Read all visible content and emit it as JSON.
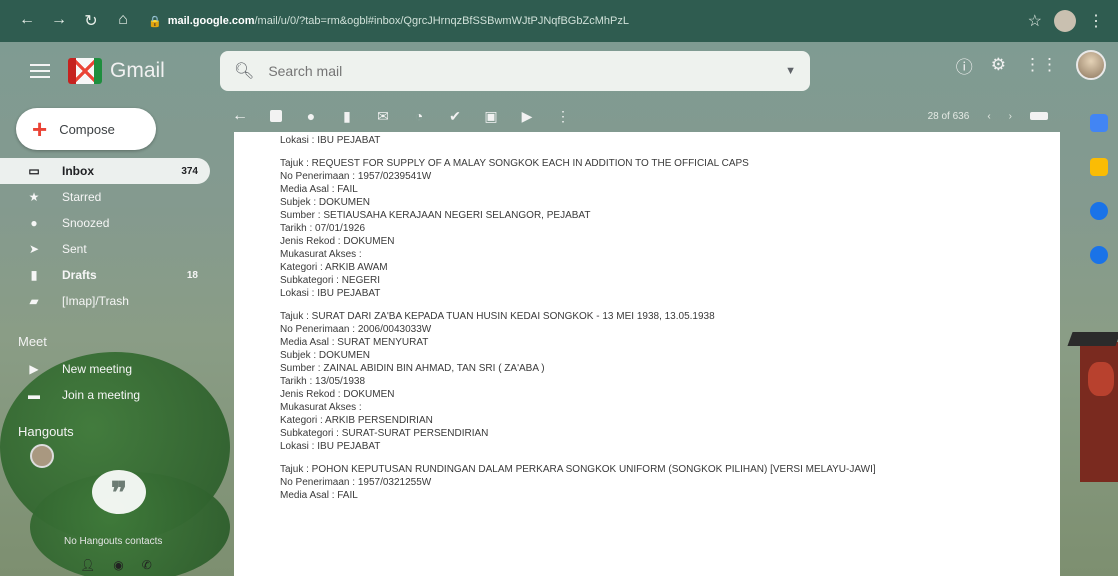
{
  "browser": {
    "url_host": "mail.google.com",
    "url_path": "/mail/u/0/?tab=rm&ogbl#inbox/QgrcJHrnqzBfSSBwmWJtPJNqfBGbZcMhPzL"
  },
  "app": {
    "name": "Gmail"
  },
  "search": {
    "placeholder": "Search mail"
  },
  "compose": {
    "label": "Compose"
  },
  "nav": [
    {
      "label": "Inbox",
      "count": "374",
      "icon": "inbox-icon",
      "glyph": "▭"
    },
    {
      "label": "Starred",
      "count": "",
      "icon": "star-icon",
      "glyph": "★"
    },
    {
      "label": "Snoozed",
      "count": "",
      "icon": "clock-icon",
      "glyph": "●"
    },
    {
      "label": "Sent",
      "count": "",
      "icon": "send-icon",
      "glyph": "➤"
    },
    {
      "label": "Drafts",
      "count": "18",
      "icon": "draft-icon",
      "glyph": "▮"
    },
    {
      "label": "[Imap]/Trash",
      "count": "",
      "icon": "label-icon",
      "glyph": "▰"
    }
  ],
  "meet": {
    "title": "Meet",
    "new_meeting": "New meeting",
    "join": "Join a meeting"
  },
  "hangouts": {
    "title": "Hangouts",
    "no_contacts": "No Hangouts contacts"
  },
  "pager": {
    "text": "28 of 636"
  },
  "message": {
    "lead": "Lokasi : IBU PEJABAT",
    "records": [
      [
        "Tajuk : REQUEST FOR SUPPLY OF A MALAY SONGKOK EACH IN ADDITION TO THE OFFICIAL CAPS",
        "No Penerimaan : 1957/0239541W",
        "Media Asal : FAIL",
        "Subjek : DOKUMEN",
        "Sumber : SETIAUSAHA KERAJAAN NEGERI SELANGOR, PEJABAT",
        "Tarikh : 07/01/1926",
        "Jenis Rekod : DOKUMEN",
        "Mukasurat Akses :",
        "Kategori : ARKIB AWAM",
        "Subkategori : NEGERI",
        "Lokasi : IBU PEJABAT"
      ],
      [
        "Tajuk : SURAT DARI ZA'BA KEPADA TUAN HUSIN KEDAI SONGKOK - 13 MEI 1938, 13.05.1938",
        "No Penerimaan : 2006/0043033W",
        "Media Asal : SURAT MENYURAT",
        "Subjek : DOKUMEN",
        "Sumber : ZAINAL ABIDIN BIN AHMAD, TAN SRI ( ZA'ABA )",
        "Tarikh : 13/05/1938",
        "Jenis Rekod : DOKUMEN",
        "Mukasurat Akses :",
        "Kategori : ARKIB PERSENDIRIAN",
        "Subkategori : SURAT-SURAT PERSENDIRIAN",
        "Lokasi : IBU PEJABAT"
      ],
      [
        "Tajuk : POHON KEPUTUSAN RUNDINGAN DALAM PERKARA SONGKOK UNIFORM (SONGKOK PILIHAN) [VERSI MELAYU-JAWI]",
        "No Penerimaan : 1957/0321255W",
        "Media Asal : FAIL"
      ]
    ]
  },
  "colors": {
    "chrome": "#2f5c50",
    "accent_red": "#ea4335",
    "panel": "#ffffff"
  }
}
